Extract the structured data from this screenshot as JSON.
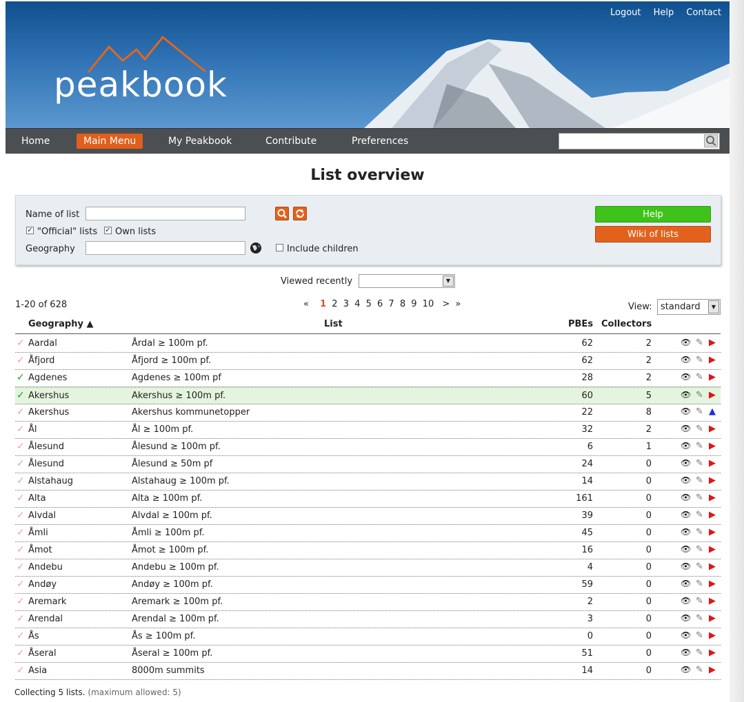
{
  "header": {
    "logo_text": "peakbook",
    "links": [
      "Logout",
      "Help",
      "Contact"
    ]
  },
  "nav": {
    "items": [
      "Home",
      "Main Menu",
      "My Peakbook",
      "Contribute",
      "Preferences"
    ],
    "active": "Main Menu",
    "search_value": ""
  },
  "page": {
    "title": "List overview"
  },
  "filters": {
    "name_label": "Name of list",
    "name_value": "",
    "official_label": "\"Official\" lists",
    "official_checked": true,
    "own_label": "Own lists",
    "own_checked": true,
    "geography_label": "Geography",
    "geography_value": "",
    "include_children_label": "Include children",
    "include_children_checked": false,
    "help_button": "Help",
    "wiki_button": "Wiki of lists"
  },
  "viewed_recently": {
    "label": "Viewed recently",
    "value": ""
  },
  "results": {
    "range": "1-20 of 628",
    "pages": [
      "«",
      "1",
      "2",
      "3",
      "4",
      "5",
      "6",
      "7",
      "8",
      "9",
      "10",
      ">",
      "»"
    ],
    "current_page": "1",
    "view_label": "View:",
    "view_value": "standard"
  },
  "table": {
    "headers": {
      "geography": "Geography ▲",
      "list": "List",
      "pbes": "PBEs",
      "collectors": "Collectors"
    },
    "rows": [
      {
        "geo": "Aardal",
        "list": "Årdal ≥ 100m pf.",
        "pbes": "62",
        "collectors": "2",
        "done": false,
        "hl": false,
        "marker": "red"
      },
      {
        "geo": "Åfjord",
        "list": "Åfjord ≥ 100m pf.",
        "pbes": "62",
        "collectors": "2",
        "done": false,
        "hl": false,
        "marker": "red"
      },
      {
        "geo": "Agdenes",
        "list": "Agdenes ≥ 100m pf",
        "pbes": "28",
        "collectors": "2",
        "done": true,
        "hl": false,
        "marker": "red"
      },
      {
        "geo": "Akershus",
        "list": "Akershus ≥ 100m pf.",
        "pbes": "60",
        "collectors": "5",
        "done": true,
        "hl": true,
        "marker": "red"
      },
      {
        "geo": "Akershus",
        "list": "Akershus kommunetopper",
        "pbes": "22",
        "collectors": "8",
        "done": false,
        "hl": false,
        "marker": "blue"
      },
      {
        "geo": "Ål",
        "list": "Ål ≥ 100m pf.",
        "pbes": "32",
        "collectors": "2",
        "done": false,
        "hl": false,
        "marker": "red"
      },
      {
        "geo": "Ålesund",
        "list": "Ålesund ≥ 100m pf.",
        "pbes": "6",
        "collectors": "1",
        "done": false,
        "hl": false,
        "marker": "red"
      },
      {
        "geo": "Ålesund",
        "list": "Ålesund ≥ 50m pf",
        "pbes": "24",
        "collectors": "0",
        "done": false,
        "hl": false,
        "marker": "red"
      },
      {
        "geo": "Alstahaug",
        "list": "Alstahaug ≥ 100m pf.",
        "pbes": "14",
        "collectors": "0",
        "done": false,
        "hl": false,
        "marker": "red"
      },
      {
        "geo": "Alta",
        "list": "Alta ≥ 100m pf.",
        "pbes": "161",
        "collectors": "0",
        "done": false,
        "hl": false,
        "marker": "red"
      },
      {
        "geo": "Alvdal",
        "list": "Alvdal ≥ 100m pf.",
        "pbes": "39",
        "collectors": "0",
        "done": false,
        "hl": false,
        "marker": "red"
      },
      {
        "geo": "Åmli",
        "list": "Åmli ≥ 100m pf.",
        "pbes": "45",
        "collectors": "0",
        "done": false,
        "hl": false,
        "marker": "red"
      },
      {
        "geo": "Åmot",
        "list": "Åmot ≥ 100m pf.",
        "pbes": "16",
        "collectors": "0",
        "done": false,
        "hl": false,
        "marker": "red"
      },
      {
        "geo": "Andebu",
        "list": "Andebu ≥ 100m pf.",
        "pbes": "4",
        "collectors": "0",
        "done": false,
        "hl": false,
        "marker": "red"
      },
      {
        "geo": "Andøy",
        "list": "Andøy ≥ 100m pf.",
        "pbes": "59",
        "collectors": "0",
        "done": false,
        "hl": false,
        "marker": "red"
      },
      {
        "geo": "Aremark",
        "list": "Aremark ≥ 100m pf.",
        "pbes": "2",
        "collectors": "0",
        "done": false,
        "hl": false,
        "marker": "red"
      },
      {
        "geo": "Arendal",
        "list": "Arendal ≥ 100m pf.",
        "pbes": "3",
        "collectors": "0",
        "done": false,
        "hl": false,
        "marker": "red"
      },
      {
        "geo": "Ås",
        "list": "Ås ≥ 100m pf.",
        "pbes": "0",
        "collectors": "0",
        "done": false,
        "hl": false,
        "marker": "red"
      },
      {
        "geo": "Åseral",
        "list": "Åseral ≥ 100m pf.",
        "pbes": "51",
        "collectors": "0",
        "done": false,
        "hl": false,
        "marker": "red"
      },
      {
        "geo": "Asia",
        "list": "8000m summits",
        "pbes": "14",
        "collectors": "0",
        "done": false,
        "hl": false,
        "marker": "red"
      }
    ]
  },
  "footer": {
    "collecting": "Collecting 5 lists.",
    "max": "(maximum allowed: 5)"
  }
}
